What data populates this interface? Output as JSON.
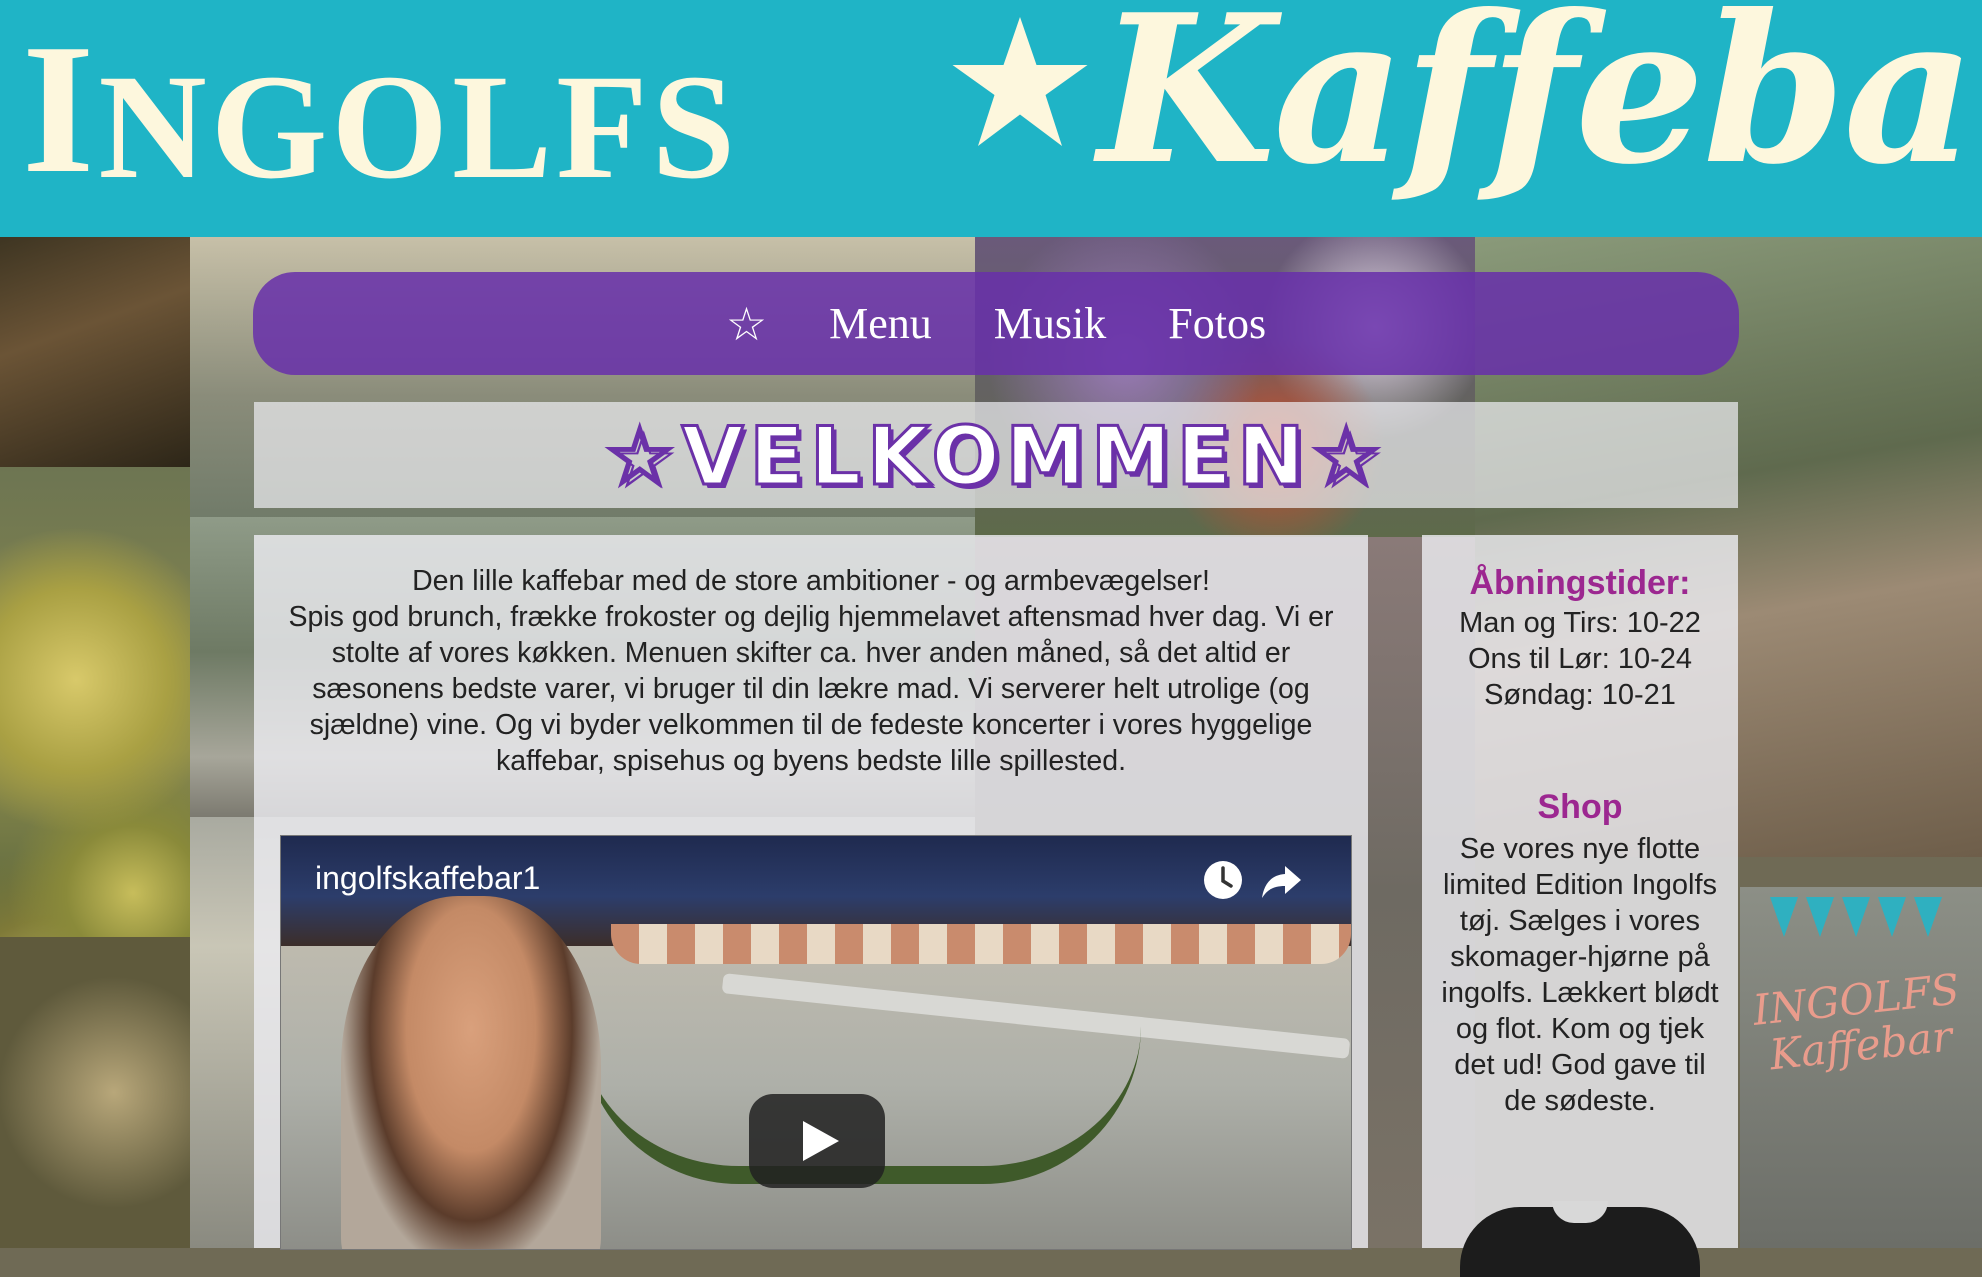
{
  "header": {
    "logo_left_initial": "I",
    "logo_left_rest": "NGOLFS",
    "logo_right": "Kaffebar"
  },
  "nav": {
    "star": "☆",
    "items": [
      "Menu",
      "Musik",
      "Fotos"
    ]
  },
  "title": "☆VELKOMMEN☆",
  "intro": {
    "lines": [
      "Den lille kaffebar med de store ambitioner - og armbevægelser!",
      "Spis god brunch, frække frokoster og dejlig hjemmelavet aftensmad hver dag. Vi er stolte af vores køkken. Menuen skifter ca. hver anden måned, så det altid er sæsonens bedste varer, vi bruger til din lækre mad. Vi serverer helt utrolige (og sjældne) vine. Og vi byder velkommen til de fedeste koncerter i vores hyggelige kaffebar, spisehus og byens bedste lille spillested."
    ]
  },
  "video": {
    "channel": "ingolfskaffebar1",
    "icons": [
      "clock-icon",
      "share-icon",
      "play-icon"
    ]
  },
  "sidebar": {
    "hours_heading": "Åbningstider:",
    "hours": [
      "Man og Tirs: 10-22",
      "Ons til Lør: 10-24",
      "Søndag: 10-21"
    ],
    "shop_heading": "Shop",
    "shop_text": "Se vores nye flotte limited Edition Ingolfs tøj. Sælges i vores skomager-hjørne på ingolfs. Lækkert blødt og flot. Kom og tjek det ud! God gave til de sødeste."
  },
  "background_sign": {
    "line1": "INGOLFS",
    "line2": "Kaffebar"
  },
  "colors": {
    "header_bg": "#1fb4c6",
    "logo_text": "#fdf7dd",
    "nav_bg": "#6830aa",
    "accent_purple": "#6b31a8",
    "heading_magenta": "#9c2790"
  }
}
